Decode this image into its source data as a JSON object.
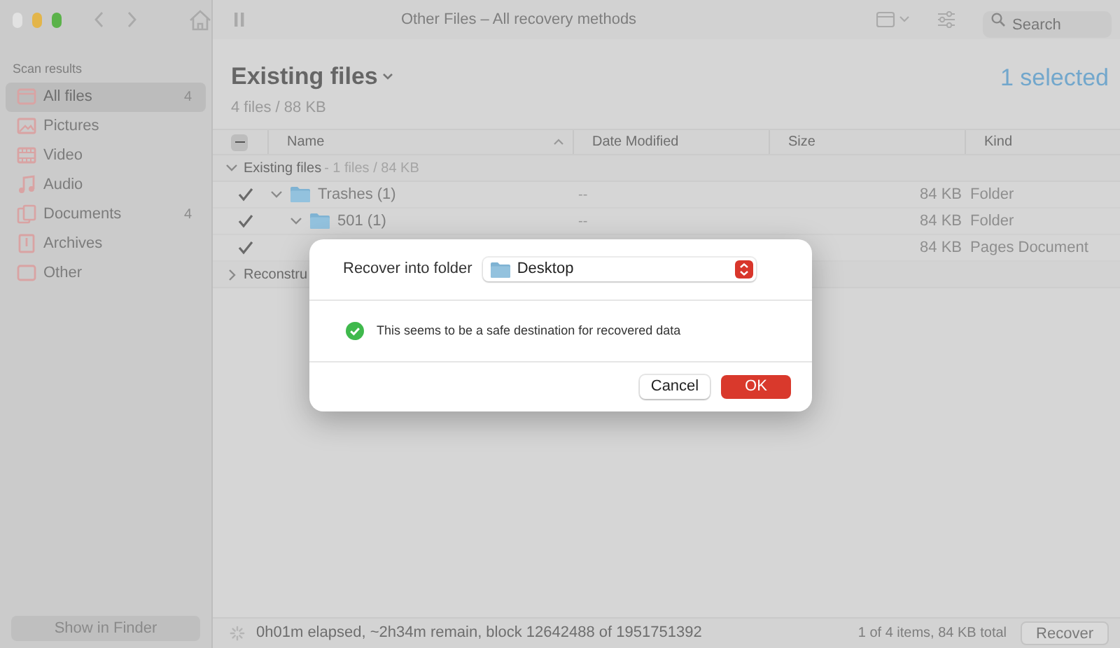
{
  "window": {
    "title": "Other Files – All recovery methods"
  },
  "toolbar": {
    "search": {
      "placeholder": "Search"
    }
  },
  "sidebar": {
    "section_title": "Scan results",
    "items": [
      {
        "label": "All files",
        "count": "4",
        "selected": true
      },
      {
        "label": "Pictures",
        "selected": false
      },
      {
        "label": "Video",
        "selected": false
      },
      {
        "label": "Audio",
        "selected": false
      },
      {
        "label": "Documents",
        "count": "4",
        "selected": false
      },
      {
        "label": "Archives",
        "selected": false
      },
      {
        "label": "Other",
        "selected": false
      }
    ],
    "show_in_finder": "Show in Finder"
  },
  "header": {
    "title": "Existing files",
    "subtitle": "4 files / 88 KB",
    "selection": "1 selected"
  },
  "table": {
    "select_all_mixed": true,
    "columns": [
      {
        "label": "Name",
        "sorted": true
      },
      {
        "label": "Date Modified",
        "sorted": false
      },
      {
        "label": "Size",
        "sorted": false
      },
      {
        "label": "Kind",
        "sorted": false
      }
    ],
    "rows": [
      {
        "kind": "group",
        "label": "Existing files",
        "summary": "- 1 files / 84 KB",
        "expanded": true,
        "children": [
          {
            "kind": "item",
            "checked": true,
            "expanded": true,
            "name": "Trashes (1)",
            "date": "--",
            "size": "84 KB",
            "type": "Folder",
            "children": [
              {
                "kind": "item",
                "checked": true,
                "expanded": true,
                "name": "501 (1)",
                "date": "--",
                "size": "84 KB",
                "type": "Folder",
                "children": [
                  {
                    "kind": "file",
                    "checked": true,
                    "size": "84 KB",
                    "type": "Pages Document"
                  }
                ]
              }
            ]
          }
        ]
      },
      {
        "kind": "group",
        "label": "Reconstru",
        "expanded": false
      }
    ]
  },
  "status_bar": {
    "scanning": true,
    "progress": "0h01m elapsed, ~2h34m remain, block 12642488 of 1951751392",
    "summary": "1 of 4 items, 84 KB total",
    "recover_button": "Recover"
  },
  "dialog": {
    "label": "Recover into folder",
    "folder": "Desktop",
    "message": "This seems to be a safe destination for recovered data",
    "buttons": [
      {
        "label": "Cancel",
        "kind": "secondary"
      },
      {
        "label": "OK",
        "kind": "primary"
      }
    ]
  }
}
